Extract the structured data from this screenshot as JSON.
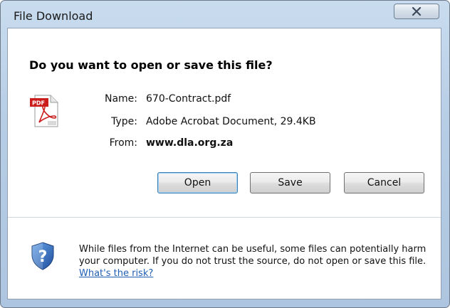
{
  "window": {
    "title": "File Download"
  },
  "dialog": {
    "question": "Do you want to open or save this file?",
    "file_icon": "pdf-file-icon",
    "file": {
      "name_label": "Name:",
      "name": "670-Contract.pdf",
      "type_label": "Type:",
      "type": "Adobe Acrobat Document, 29.4KB",
      "from_label": "From:",
      "from": "www.dla.org.za"
    },
    "buttons": {
      "open": "Open",
      "save": "Save",
      "cancel": "Cancel"
    },
    "warning": {
      "icon": "shield-question-icon",
      "text": "While files from the Internet can be useful, some files can potentially harm your computer. If you do not trust the source, do not open or save this file.",
      "link": "What's the risk?"
    }
  },
  "colors": {
    "titlebar": "#b7cde6",
    "link": "#1f5fb5",
    "shield": "#2f6fc4"
  }
}
